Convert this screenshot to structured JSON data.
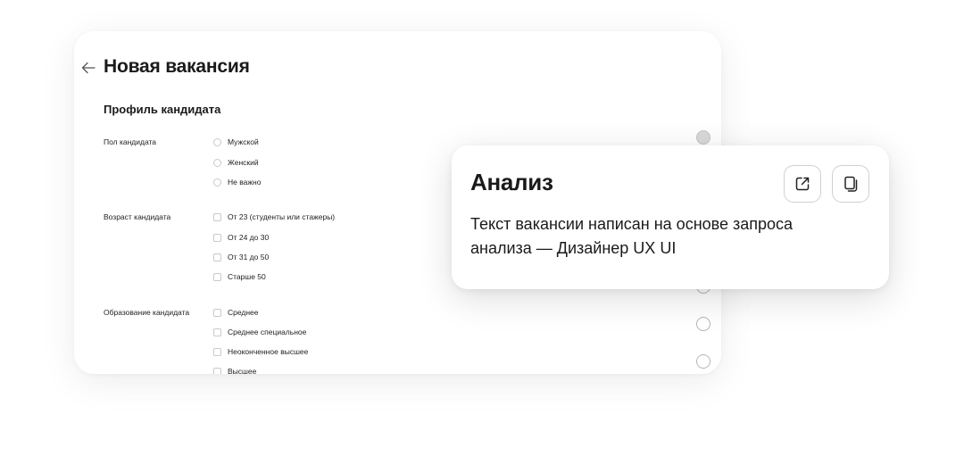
{
  "main": {
    "title": "Новая вакансия",
    "section_title": "Профиль кандидата",
    "fields": {
      "gender": {
        "label": "Пол кандидата",
        "options": [
          "Мужской",
          "Женский",
          "Не важно"
        ]
      },
      "age": {
        "label": "Возраст кандидата",
        "options": [
          "От 23 (студенты или стажеры)",
          "От 24 до 30",
          "От 31 до 50",
          "Старше 50"
        ]
      },
      "education": {
        "label": "Образование кандидата",
        "options": [
          "Среднее",
          "Среднее специальное",
          "Неоконченное высшее",
          "Высшее"
        ]
      }
    }
  },
  "analysis": {
    "title": "Анализ",
    "text": "Текст вакансии написан на основе запроса анализа — Дизайнер UX UI",
    "open_icon": "external-link-icon",
    "copy_icon": "copy-icon"
  },
  "colors": {
    "border": "#c9c9c9",
    "text": "#1a1a1a",
    "background": "#ffffff"
  }
}
